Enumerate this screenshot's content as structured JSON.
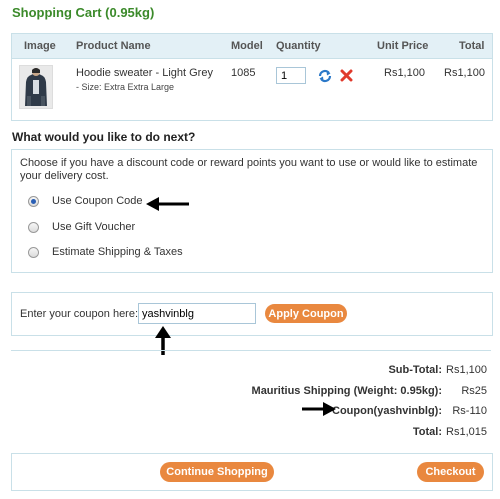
{
  "header": {
    "title": "Shopping Cart  (0.95kg)"
  },
  "cart": {
    "columns": {
      "image": "Image",
      "product_name": "Product Name",
      "model": "Model",
      "quantity": "Quantity",
      "unit_price": "Unit Price",
      "total": "Total"
    },
    "items": [
      {
        "name": "Hoodie sweater - Light Grey",
        "option": "- Size: Extra Extra Large",
        "model": "1085",
        "quantity": "1",
        "unit_price": "Rs1,100",
        "total": "Rs1,100"
      }
    ]
  },
  "next": {
    "title": "What would you like to do next?",
    "intro": "Choose if you have a discount code or reward points you want to use or would like to estimate your delivery cost.",
    "options": [
      {
        "label": "Use Coupon Code",
        "checked": true
      },
      {
        "label": "Use Gift Voucher",
        "checked": false
      },
      {
        "label": "Estimate Shipping & Taxes",
        "checked": false
      }
    ]
  },
  "coupon": {
    "label": "Enter your coupon here:",
    "value": "yashvinblg",
    "button": "Apply Coupon"
  },
  "totals": [
    {
      "label": "Sub-Total:",
      "value": "Rs1,100"
    },
    {
      "label": "Mauritius Shipping (Weight: 0.95kg):",
      "value": "Rs25"
    },
    {
      "label": "Coupon(yashvinblg):",
      "value": "Rs-110"
    },
    {
      "label": "Total:",
      "value": "Rs1,015"
    }
  ],
  "actions": {
    "continue": "Continue Shopping",
    "checkout": "Checkout"
  },
  "colors": {
    "title_green": "#3b8a2a",
    "button_orange": "#e9883f",
    "border_blue": "#c9e0e8",
    "header_bg": "#e3f0f6"
  },
  "icons": [
    "update-icon",
    "remove-icon",
    "left-arrow-icon",
    "up-arrow-icon",
    "right-arrow-icon"
  ]
}
